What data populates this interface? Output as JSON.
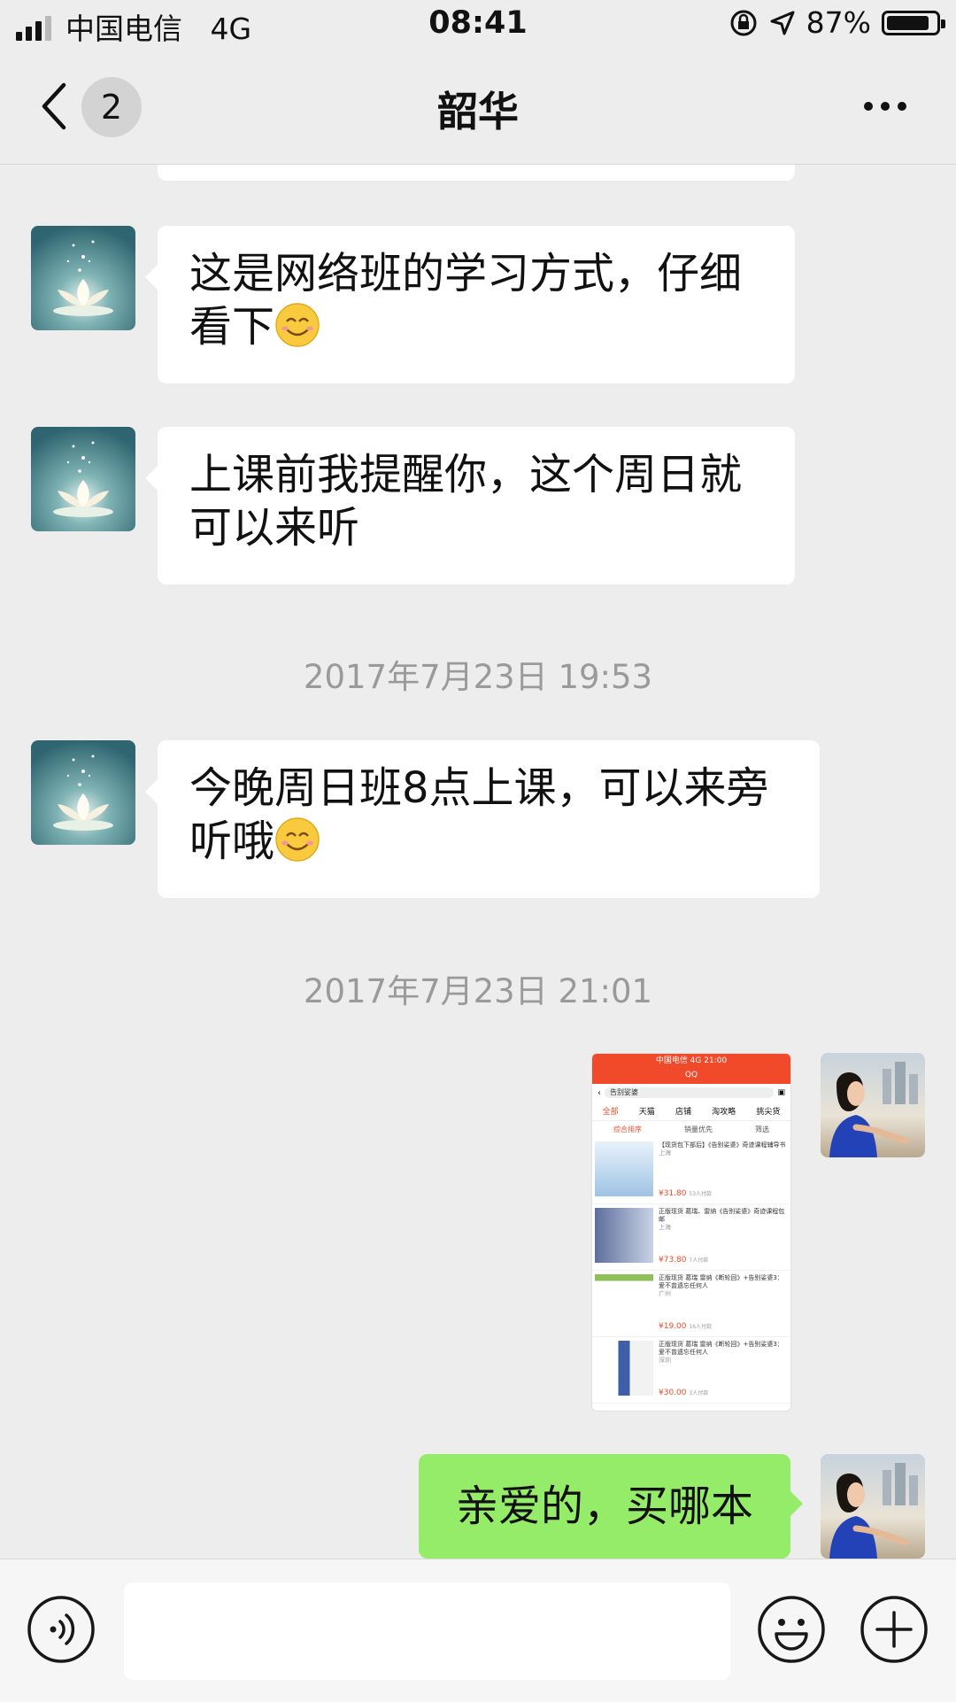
{
  "status_bar": {
    "carrier": "中国电信",
    "network": "4G",
    "time": "08:41",
    "battery_percent": "87%",
    "battery_level": 0.87
  },
  "nav": {
    "back_count": "2",
    "title": "韶华"
  },
  "messages": [
    {
      "side": "left",
      "text": "这是网络班的学习方式，仔细看下",
      "emoji": "smiling-face-emoji"
    },
    {
      "side": "left",
      "text": "上课前我提醒你，这个周日就可以来听"
    },
    {
      "type": "timestamp",
      "text": "2017年7月23日 19:53"
    },
    {
      "side": "left",
      "text": "今晚周日班8点上课，可以来旁听哦",
      "emoji": "smiling-face-emoji"
    },
    {
      "type": "timestamp",
      "text": "2017年7月23日 21:01"
    },
    {
      "side": "right",
      "type": "image"
    },
    {
      "side": "right",
      "text": "亲爱的，买哪本"
    }
  ],
  "shared_screenshot": {
    "status": "中国电信 4G  21:00",
    "app": "QQ",
    "search": "告别娑婆",
    "tabs": [
      "全部",
      "天猫",
      "店铺",
      "淘攻略",
      "挑尖货"
    ],
    "sort": [
      "综合排序",
      "销量优先",
      "筛选"
    ],
    "items": [
      {
        "title": "【现货包下部后】《告别娑婆》奇迹课程辅导书",
        "location": "上海",
        "price": "¥31.80",
        "sales": "53人付款"
      },
      {
        "title": "正版现货 葛瑞、雷纳《告别娑婆》奇迹课程包邮",
        "location": "上海",
        "price": "¥73.80",
        "sales": "7人付款"
      },
      {
        "title": "正版现货 葛瑞 雷纳《断轮回》+告别娑婆3：爱不曾遗忘任何人",
        "location": "广州",
        "price": "¥19.00",
        "sales": "16人付款"
      },
      {
        "title": "正版现货 葛瑞 雷纳《断轮回》+告别娑婆3：爱不曾遗忘任何人",
        "location": "深圳",
        "price": "¥30.00",
        "sales": "3人付款"
      }
    ]
  },
  "colors": {
    "background": "#ededed",
    "bubble_received": "#ffffff",
    "bubble_sent": "#95ec69",
    "timestamp": "#9a9a9a",
    "accent": "#f04a2a"
  }
}
